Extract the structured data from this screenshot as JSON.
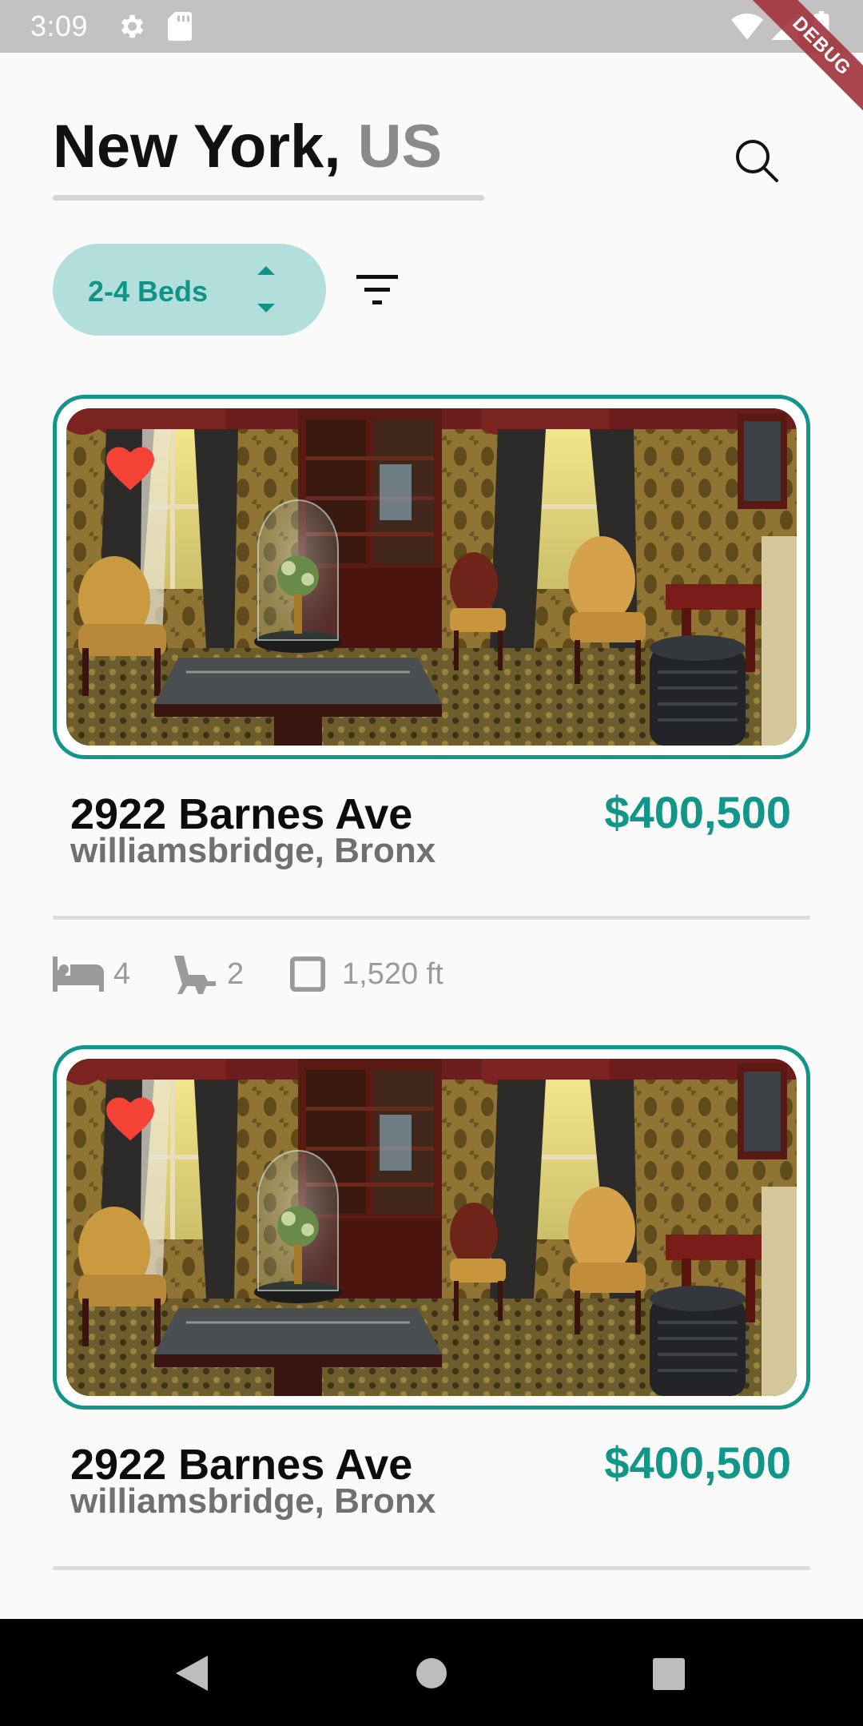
{
  "status_bar": {
    "time": "3:09",
    "icons": [
      "gear-icon",
      "sd-card-icon",
      "wifi-icon",
      "signal-icon",
      "battery-icon"
    ]
  },
  "debug_banner": "DEBUG",
  "header": {
    "city": "New York,",
    "country": "US",
    "search_icon": "search-icon"
  },
  "filters": {
    "beds_label": "2-4 Beds",
    "beds_arrows_icon": "unfold-arrows-icon",
    "filter_icon": "filter-list-icon"
  },
  "listings": [
    {
      "address": "2922 Barnes Ave",
      "neighborhood": "williamsbridge, Bronx",
      "price": "$400,500",
      "favorited": true,
      "beds": "4",
      "baths": "2",
      "area": "1,520 ft"
    },
    {
      "address": "2922 Barnes Ave",
      "neighborhood": "williamsbridge, Bronx",
      "price": "$400,500",
      "favorited": true
    }
  ],
  "colors": {
    "accent": "#13968a",
    "pill_bg": "#b2dfdb",
    "heart": "#f44336",
    "status_bar": "#c2c2c2"
  },
  "nav_bar": {
    "icons": [
      "back-icon",
      "home-icon",
      "recents-icon"
    ]
  }
}
